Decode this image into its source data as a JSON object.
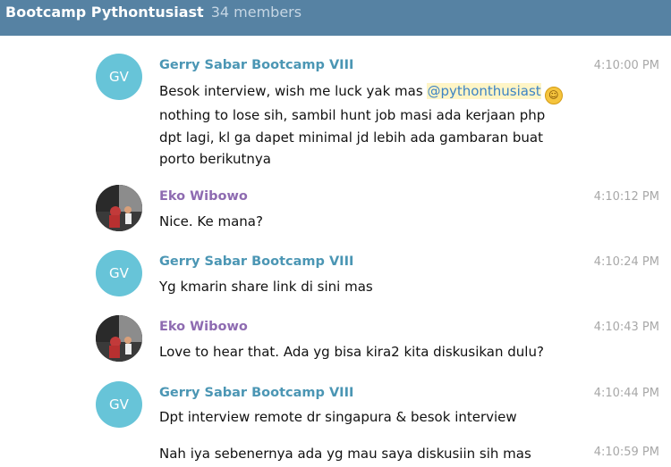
{
  "header": {
    "title": "Bootcamp Pythontusiast",
    "members": "34 members"
  },
  "messages": [
    {
      "sender": "Gerry Sabar Bootcamp VIII",
      "initials": "GV",
      "time": "4:10:00 PM",
      "text_before": "Besok interview, wish me luck yak mas",
      "mention": "@pythonthusiast",
      "emoji": "grinning-face-icon",
      "text_after": "nothing to lose sih, sambil hunt job masi ada kerjaan php dpt lagi, kl ga dapet minimal jd lebih ada gambaran buat porto berikutnya"
    },
    {
      "sender": "Eko Wibowo",
      "time": "4:10:12 PM",
      "text": "Nice. Ke mana?"
    },
    {
      "sender": "Gerry Sabar Bootcamp VIII",
      "initials": "GV",
      "time": "4:10:24 PM",
      "text": "Yg kmarin share link di sini mas"
    },
    {
      "sender": "Eko Wibowo",
      "time": "4:10:43 PM",
      "text": "Love to hear that. Ada yg bisa kira2 kita diskusikan dulu?"
    },
    {
      "sender": "Gerry Sabar Bootcamp VIII",
      "initials": "GV",
      "time": "4:10:44 PM",
      "text": "Dpt interview remote dr singapura & besok interview"
    },
    {
      "time": "4:10:59 PM",
      "text": "Nah iya sebenernya ada yg mau saya diskusiin sih mas"
    }
  ],
  "colors": {
    "header": "#5682a3",
    "gerry_name": "#4b96b4",
    "eko_name": "#8e6bb1",
    "gv_avatar": "#67c4d8"
  }
}
